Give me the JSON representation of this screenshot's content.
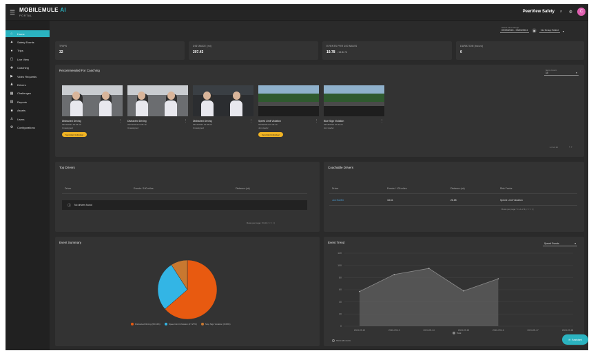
{
  "app": {
    "logo_text": "MOBILEMULE",
    "logo_ai": "AI",
    "logo_sub": "PORTAL",
    "menu_icon": "hamburger-icon"
  },
  "topbar": {
    "company": "PeerView Safety",
    "avatar_initial": "C"
  },
  "sidebar": {
    "items": [
      {
        "label": "Home",
        "icon": "home-icon",
        "glyph": "⌂",
        "active": true
      },
      {
        "label": "Safety Events",
        "icon": "warning-icon",
        "glyph": "▲",
        "active": false
      },
      {
        "label": "Trips",
        "icon": "map-pin-icon",
        "glyph": "●",
        "active": false
      },
      {
        "label": "Live View",
        "icon": "live-view-icon",
        "glyph": "▢",
        "active": false
      },
      {
        "label": "Coaching",
        "icon": "coaching-icon",
        "glyph": "✚",
        "active": false
      },
      {
        "label": "Video Requests",
        "icon": "video-icon",
        "glyph": "▶",
        "active": false
      },
      {
        "label": "Drivers",
        "icon": "drivers-icon",
        "glyph": "♟",
        "active": false
      },
      {
        "label": "Challenges",
        "icon": "challenges-icon",
        "glyph": "▦",
        "active": false
      },
      {
        "label": "Reports",
        "icon": "reports-icon",
        "glyph": "▤",
        "active": false
      },
      {
        "label": "Assets",
        "icon": "truck-icon",
        "glyph": "■",
        "active": false
      },
      {
        "label": "Users",
        "icon": "users-icon",
        "glyph": "♙",
        "active": false
      },
      {
        "label": "Configurations",
        "icon": "config-icon",
        "glyph": "⚙",
        "active": false
      }
    ]
  },
  "filters": {
    "date_caption": "Select Time Range",
    "date_value": "09/09/2024 - 09/20/2024",
    "group_value": "No Group Select"
  },
  "kpis": [
    {
      "label": "TRIPS",
      "value": "32",
      "sub": ""
    },
    {
      "label": "DISTANCE (mi)",
      "value": "207.43",
      "sub": ""
    },
    {
      "label": "EVENTS PER 100 MILES",
      "value": "19.78",
      "sub": "↓ 13.84 %"
    },
    {
      "label": "DURATION (hours)",
      "value": "0",
      "sub": ""
    }
  ],
  "coaching": {
    "title": "Recommended For Coaching",
    "select_caption": "Items Count",
    "select_value": "10",
    "events": [
      {
        "title": "Distracted Driving",
        "date": "09/19/2024 15:35:19",
        "driver": "Unassigned",
        "button": "Send Alert Individual",
        "kind": "cabin"
      },
      {
        "title": "Distracted Driving",
        "date": "09/19/2024 15:35:19",
        "driver": "Unassigned",
        "button": "",
        "kind": "cabin"
      },
      {
        "title": "Distracted Driving",
        "date": "09/19/2024 15:35:05",
        "driver": "Unassigned",
        "button": "",
        "kind": "night"
      },
      {
        "title": "Speed Limit Violation",
        "date": "09/18/2024 07:36:10",
        "driver": "Jon Hoefer",
        "button": "Send Alert Individual",
        "kind": "road"
      },
      {
        "title": "Blue Sign Violation",
        "date": "09/18/2024 07:30:20",
        "driver": "Jon Hoefer",
        "button": "",
        "kind": "road"
      }
    ],
    "pager": "1-5 of 10"
  },
  "top_drivers": {
    "title": "Top Drivers",
    "columns": [
      "Driver",
      "Events / 100 miles",
      "Distance (mi)"
    ],
    "empty_text": "No drivers found",
    "pager": "Rows per page: 5     0-0     |<   <   >   >|"
  },
  "coachable": {
    "title": "Coachable Drivers",
    "columns": [
      "Driver",
      "Events / 100 miles",
      "Distance (mi)",
      "Risk Factor"
    ],
    "rows": [
      {
        "driver": "Jon Hoefer",
        "events": "18.61",
        "distance": "26.85",
        "risk": "Speed Limit Violation"
      }
    ],
    "pager": "Rows per page: 5     1-1 of 1     |<   <   >   >|"
  },
  "event_summary": {
    "title": "Event Summary",
    "legend": [
      {
        "label": "Distracted Driving (63.64%)",
        "color": "#e85a10"
      },
      {
        "label": "Speed Limit Violation (27.27%)",
        "color": "#33b5e5"
      },
      {
        "label": "Stop Sign Violation (9.09%)",
        "color": "#c87830"
      }
    ]
  },
  "event_trend": {
    "title": "Event Trend",
    "select_value": "Speed Events",
    "legend_label": "Total",
    "checkbox_label": "Show all events"
  },
  "assistant": {
    "label": "Assistant"
  },
  "chart_data": [
    {
      "type": "pie",
      "title": "Event Summary",
      "labels": [
        "Distracted Driving",
        "Speed Limit Violation",
        "Stop Sign Violation"
      ],
      "values": [
        63.64,
        27.27,
        9.09
      ],
      "colors": [
        "#e85a10",
        "#33b5e5",
        "#c87830"
      ],
      "legend_position": "bottom"
    },
    {
      "type": "area",
      "title": "Event Trend",
      "x": [
        "2024-09-12",
        "2024-09-13",
        "2024-09-14",
        "2024-09-15",
        "2024-09-16",
        "2024-09-17",
        "2024-09-18"
      ],
      "series": [
        {
          "name": "Total",
          "values": [
            57,
            85,
            95,
            58,
            78,
            null,
            null
          ]
        }
      ],
      "ylim": [
        0,
        120
      ],
      "yticks": [
        0,
        20,
        40,
        60,
        80,
        100,
        120
      ],
      "grid": true,
      "legend_position": "bottom"
    }
  ]
}
